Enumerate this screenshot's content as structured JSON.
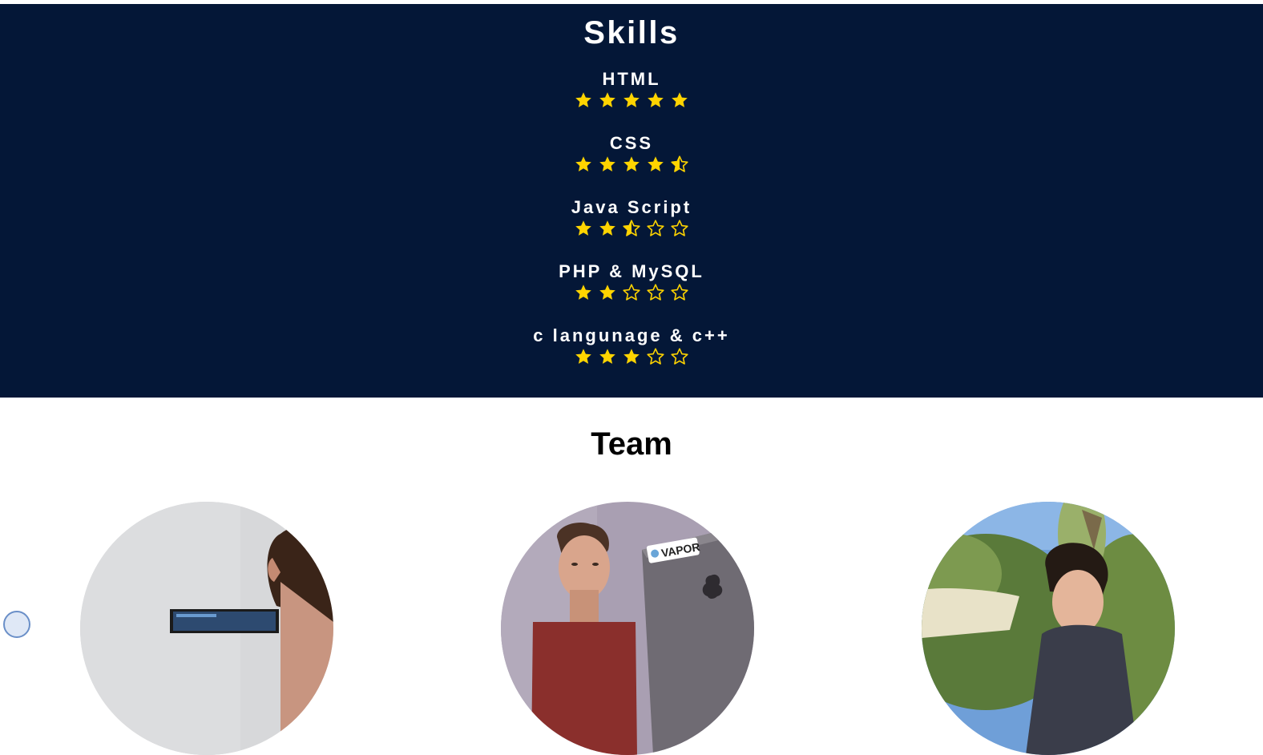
{
  "skills": {
    "title": "Skills",
    "star_color": "#ffd400",
    "background": "#041737",
    "items": [
      {
        "name": "HTML",
        "rating": 5
      },
      {
        "name": "CSS",
        "rating": 4.5
      },
      {
        "name": "Java Script",
        "rating": 2.5
      },
      {
        "name": "PHP & MySQL",
        "rating": 2
      },
      {
        "name": "c langunage & c++",
        "rating": 3
      }
    ]
  },
  "team": {
    "title": "Team",
    "members": [
      {
        "photo": "team-member-photo-1"
      },
      {
        "photo": "team-member-photo-2",
        "laptop_sticker": "VAPOR"
      },
      {
        "photo": "team-member-photo-3"
      }
    ]
  }
}
